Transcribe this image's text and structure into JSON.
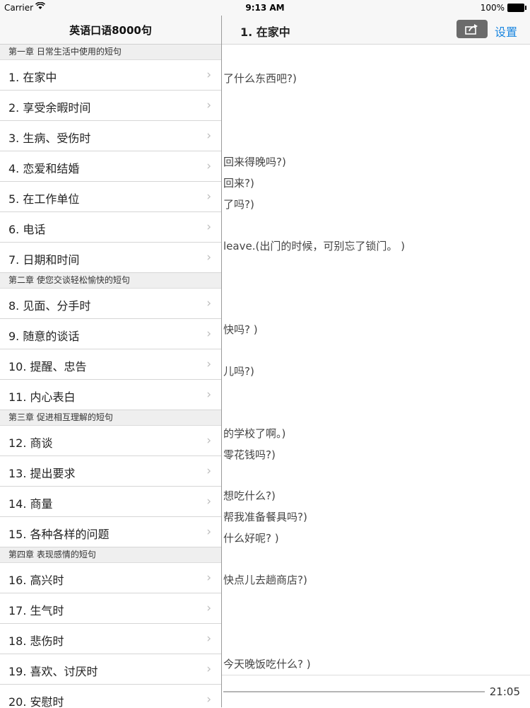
{
  "status_bar": {
    "carrier": "Carrier",
    "time": "9:13 AM",
    "battery": "100%"
  },
  "main": {
    "title": "1. 在家中",
    "settings_label": "设置",
    "lines": [
      {
        "text": "了什么东西吧?)"
      },
      {
        "text": "回来得晚吗?)"
      },
      {
        "text": "回来?)"
      },
      {
        "text": "了吗?)"
      },
      {
        "text": "leave.(出门的时候，可别忘了锁门。 )"
      },
      {
        "text": "快吗? )"
      },
      {
        "text": "儿吗?)"
      },
      {
        "text": "的学校了啊。)"
      },
      {
        "text": "零花钱吗?)"
      },
      {
        "text": "想吃什么?)"
      },
      {
        "text": "帮我准备餐具吗?)"
      },
      {
        "text": "什么好呢? )"
      },
      {
        "text": "快点儿去趟商店?)"
      },
      {
        "text": "今天晚饭吃什么? )"
      }
    ],
    "duration": "21:05"
  },
  "menu": {
    "title": "英语口语8000句",
    "sections": [
      {
        "header": "第一章 日常生活中使用的短句",
        "items": [
          "1. 在家中",
          "2. 享受余暇时间",
          "3. 生病、受伤时",
          "4. 恋爱和结婚",
          "5. 在工作单位",
          "6. 电话",
          "7. 日期和时间"
        ]
      },
      {
        "header": "第二章 使您交谈轻松愉快的短句",
        "items": [
          "8. 见面、分手时",
          "9. 随意的谈话",
          "10. 提醒、忠告",
          "11. 内心表白"
        ]
      },
      {
        "header": "第三章 促进相互理解的短句",
        "items": [
          "12. 商谈",
          "13. 提出要求",
          "14. 商量",
          "15. 各种各样的问题"
        ]
      },
      {
        "header": "第四章 表现感情的短句",
        "items": [
          "16. 高兴时",
          "17. 生气时",
          "18. 悲伤时",
          "19. 喜欢、讨厌时",
          "20. 安慰时"
        ]
      }
    ]
  }
}
